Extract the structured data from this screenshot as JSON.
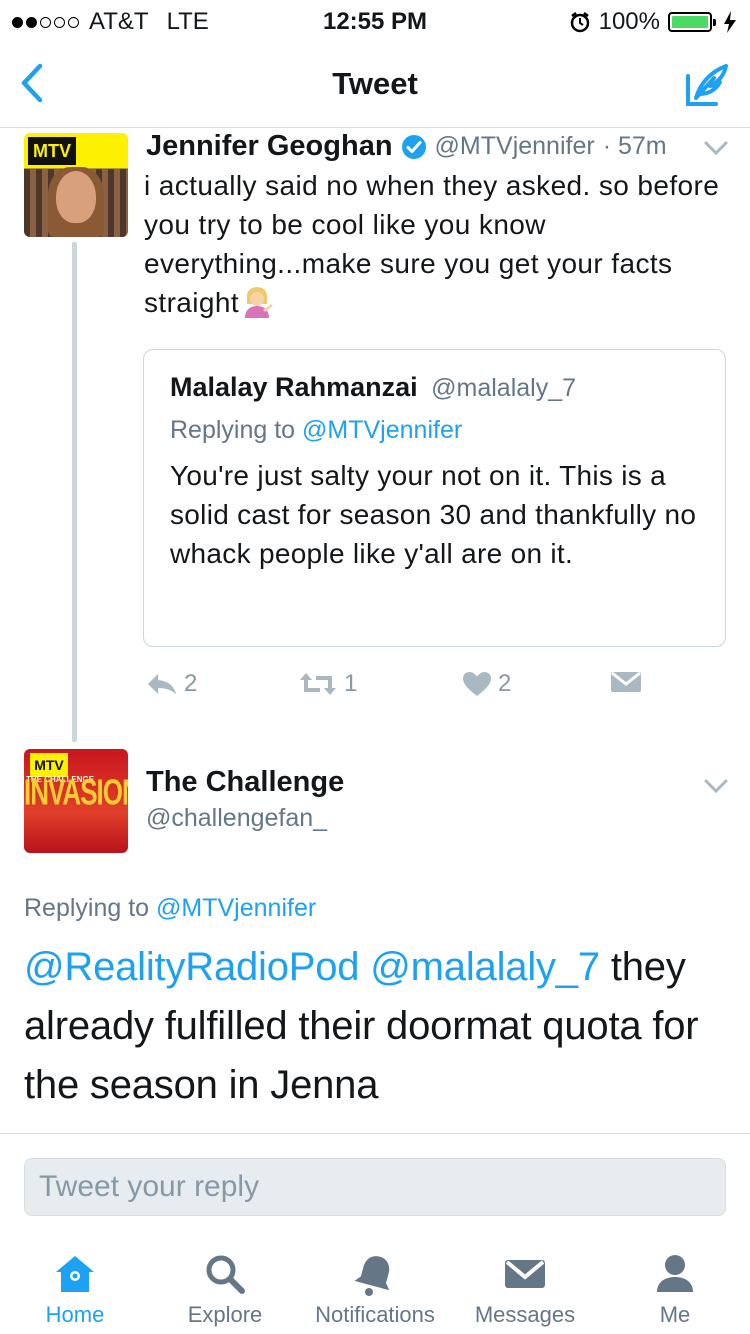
{
  "status_bar": {
    "carrier": "AT&T",
    "network": "LTE",
    "time": "12:55 PM",
    "battery": "100%",
    "battery_level": 1.0,
    "signal_bars": 2
  },
  "nav": {
    "title": "Tweet",
    "back_icon": "chevron-left-icon",
    "compose_icon": "compose-feather-icon"
  },
  "tweet1": {
    "name": "Jennifer Geoghan",
    "verified": true,
    "handle": "@MTVjennifer",
    "time": "· 57m",
    "text": "i actually said no when they asked. so before you try to be cool like you know everything...make sure you get your facts straight",
    "emoji": "person-tipping-hand",
    "quote": {
      "name": "Malalay Rahmanzai",
      "handle": "@malalaly_7",
      "replying_prefix": "Replying to ",
      "replying_to": "@MTVjennifer",
      "text": "You're just salty your not on it. This is a solid cast for season 30 and thankfully no whack people like y'all are on it."
    },
    "actions": {
      "reply_count": "2",
      "retweet_count": "1",
      "like_count": "2"
    }
  },
  "tweet2": {
    "name": "The Challenge",
    "handle": "@challengefan_",
    "replying_prefix": "Replying to ",
    "replying_to": "@MTVjennifer",
    "mention1": "@RealityRadioPod",
    "mention2": "@malalaly_7",
    "text": " they already fulfilled their doormat quota for the season in Jenna",
    "avatar_logo": "MTV",
    "avatar_text": "INVASION",
    "avatar_subtext": "THE CHALLENGE"
  },
  "reply": {
    "placeholder": "Tweet your reply"
  },
  "tabs": [
    {
      "label": "Home",
      "icon": "home-icon",
      "active": true
    },
    {
      "label": "Explore",
      "icon": "search-icon",
      "active": false
    },
    {
      "label": "Notifications",
      "icon": "bell-icon",
      "active": false
    },
    {
      "label": "Messages",
      "icon": "envelope-icon",
      "active": false
    },
    {
      "label": "Me",
      "icon": "person-icon",
      "active": false
    }
  ],
  "colors": {
    "accent": "#1da1f2",
    "secondary_text": "#657786",
    "battery": "#4cd964"
  }
}
